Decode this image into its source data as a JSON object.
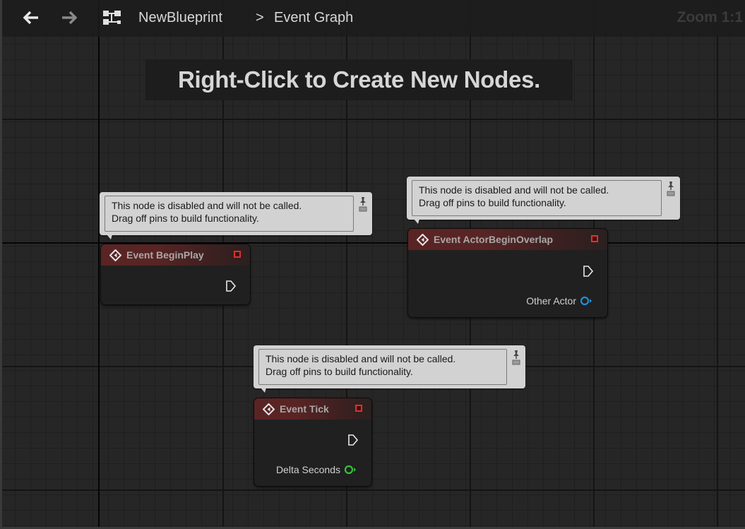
{
  "breadcrumb": {
    "blueprint_name": "NewBlueprint",
    "separator": ">",
    "graph_name": "Event Graph"
  },
  "zoom": {
    "label": "Zoom 1:1"
  },
  "hint": {
    "text": "Right-Click to Create New Nodes."
  },
  "comment_lines": {
    "line1": "This node is disabled and will not be called.",
    "line2": "Drag off pins to build functionality."
  },
  "nodes": [
    {
      "title": "Event BeginPlay",
      "outputs": []
    },
    {
      "title": "Event ActorBeginOverlap",
      "outputs": [
        {
          "label": "Other Actor",
          "color": "#1e90d6"
        }
      ]
    },
    {
      "title": "Event Tick",
      "outputs": [
        {
          "label": "Delta Seconds",
          "color": "#38c038"
        }
      ]
    }
  ],
  "colors": {
    "node_header": "#5a2424",
    "delegate_pin": "#e03030",
    "object_pin": "#1e90d6",
    "float_pin": "#38c038",
    "comment_bg": "#d2d2d2"
  },
  "icons": {
    "back": "arrow-left-icon",
    "forward": "arrow-right-icon",
    "graph": "blueprint-graph-icon",
    "event": "event-diamond-icon",
    "delegate": "delegate-square-icon",
    "exec": "exec-pin-icon",
    "pin": "comment-pin-icon"
  }
}
